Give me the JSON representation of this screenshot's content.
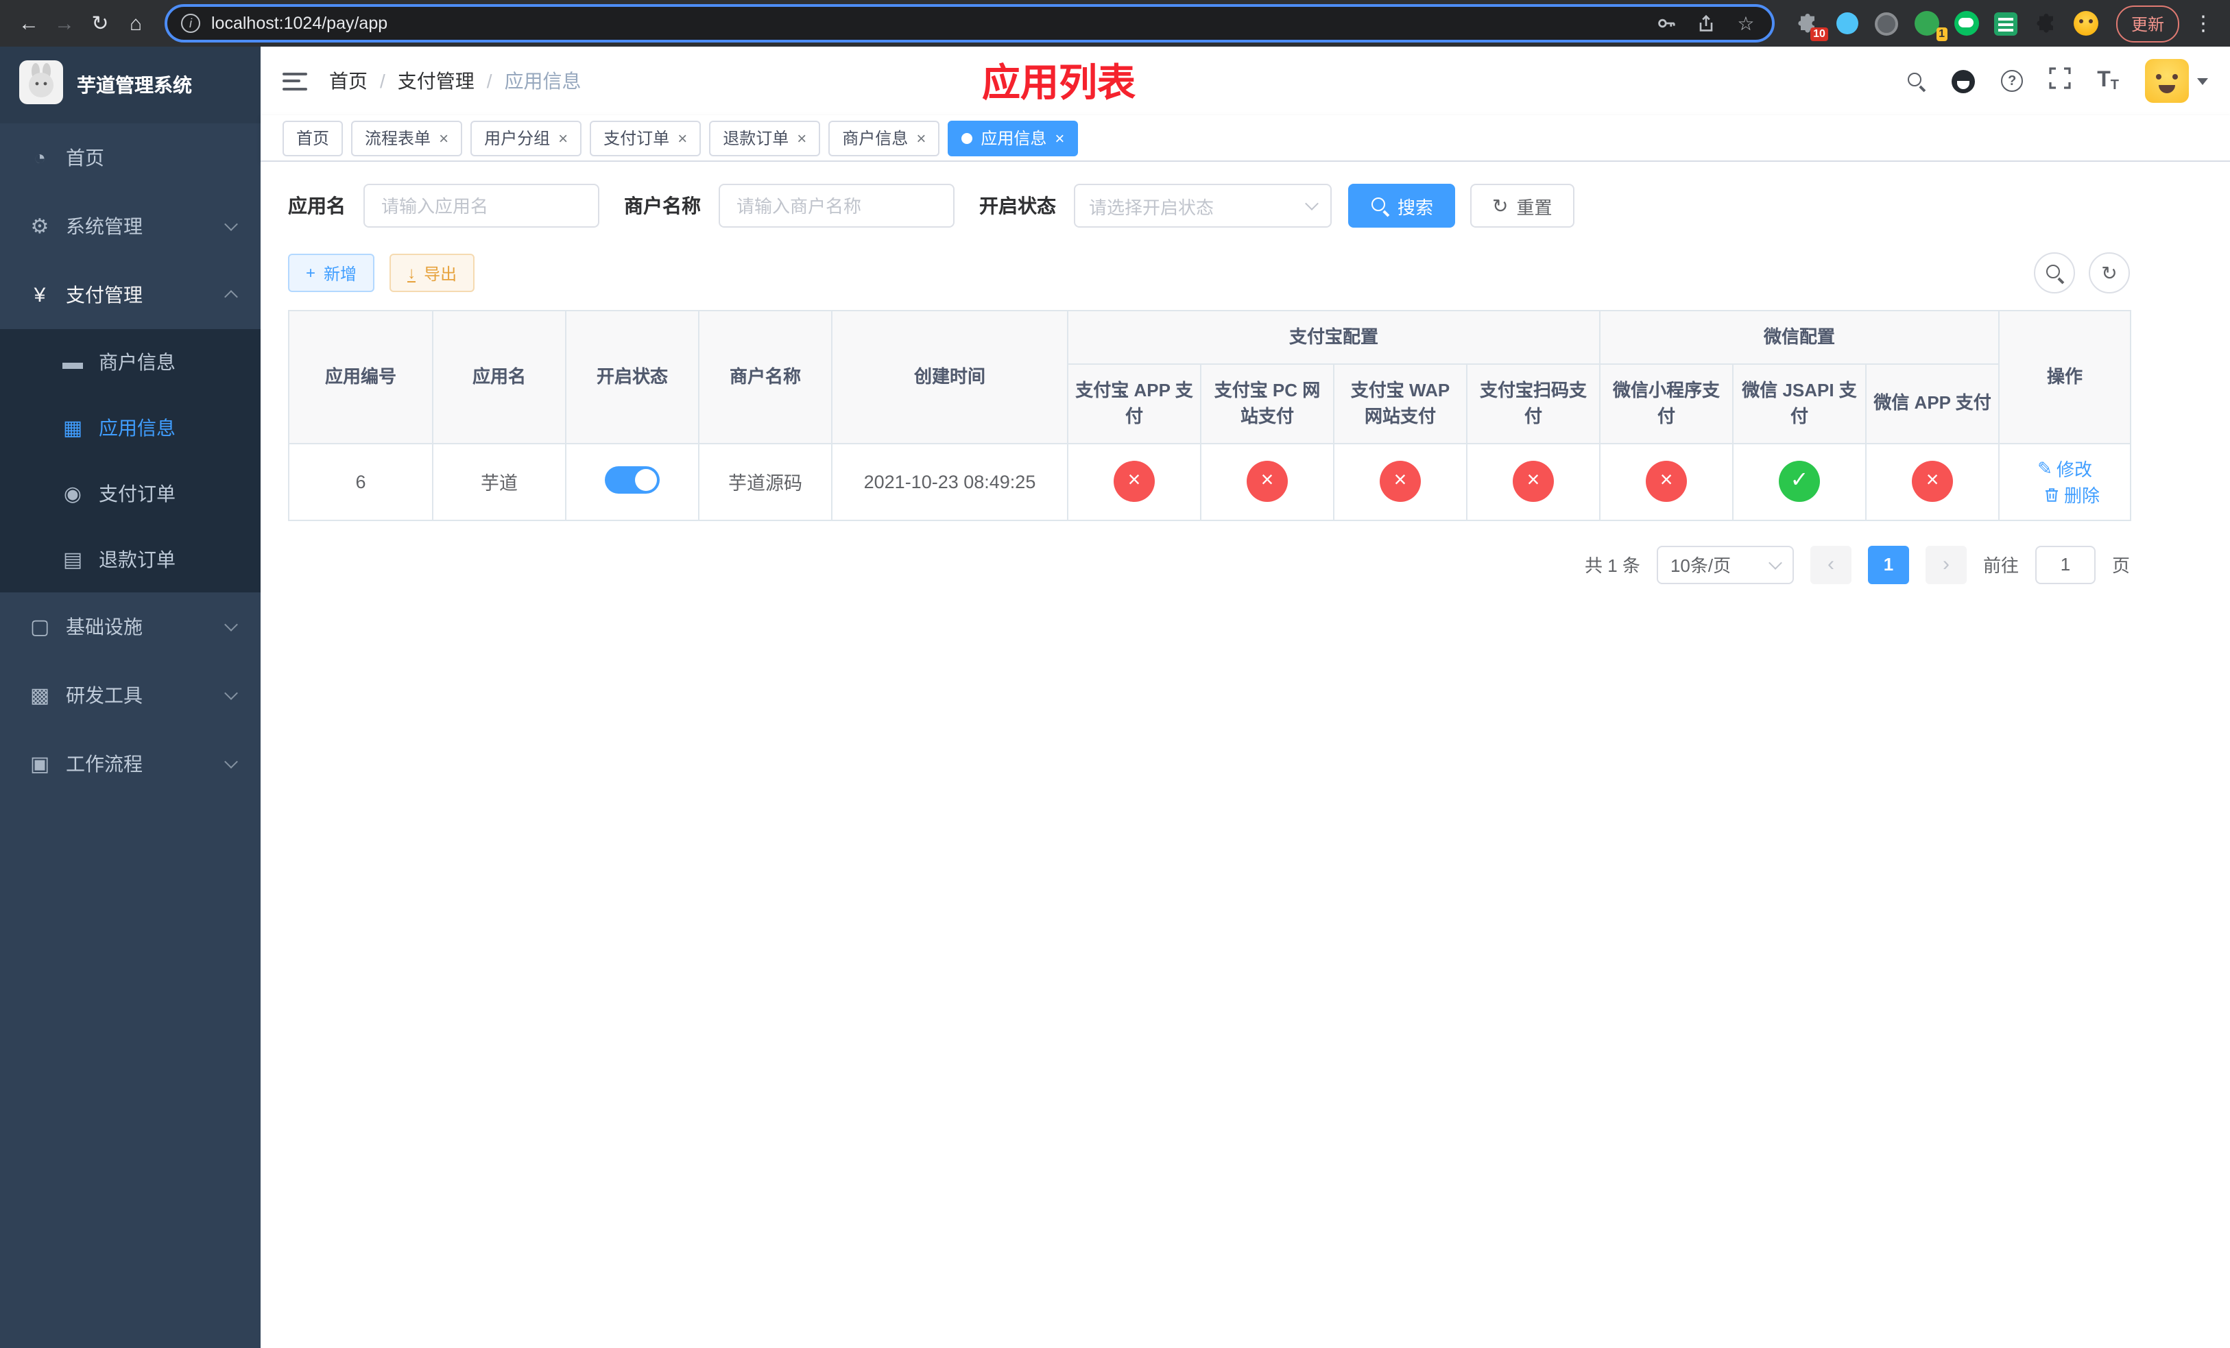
{
  "colors": {
    "accent": "#409eff",
    "danger": "#f75353",
    "success": "#2bc64c",
    "warning": "#e6a23c",
    "title_red": "#f5222d",
    "sidebar_bg": "#304156",
    "submenu_bg": "#1f2d3d"
  },
  "icons": {
    "back": "←",
    "forward": "→",
    "reload": "↻",
    "home": "⌂",
    "info": "i",
    "star": "☆",
    "menu_dots": "⋮",
    "dashboard": "◔",
    "gear": "⚙",
    "yen": "¥",
    "merchant": "▬",
    "app": "▦",
    "order": "◉",
    "refund": "▤",
    "infra": "▢",
    "tools": "▩",
    "workflow": "▣",
    "question": "?",
    "close": "×",
    "check": "✓",
    "cross": "×",
    "refresh": "↻",
    "plus": "+",
    "download": "↓",
    "edit": "✎",
    "prev": "‹",
    "next": "›",
    "font_size": "T"
  },
  "browser": {
    "url": "localhost:1024/pay/app",
    "update_label": "更新",
    "puzzle_badge": "10",
    "avatar_badge": "1"
  },
  "sidebar": {
    "title": "芋道管理系统",
    "items": [
      {
        "label": "首页"
      },
      {
        "label": "系统管理"
      },
      {
        "label": "支付管理"
      },
      {
        "label": "基础设施"
      },
      {
        "label": "研发工具"
      },
      {
        "label": "工作流程"
      }
    ],
    "payment_children": [
      {
        "label": "商户信息"
      },
      {
        "label": "应用信息"
      },
      {
        "label": "支付订单"
      },
      {
        "label": "退款订单"
      }
    ]
  },
  "header": {
    "separator": "/",
    "breadcrumb": [
      {
        "label": "首页"
      },
      {
        "label": "支付管理"
      },
      {
        "label": "应用信息"
      }
    ],
    "page_title": "应用列表"
  },
  "tabs": [
    {
      "label": "首页"
    },
    {
      "label": "流程表单"
    },
    {
      "label": "用户分组"
    },
    {
      "label": "支付订单"
    },
    {
      "label": "退款订单"
    },
    {
      "label": "商户信息"
    },
    {
      "label": "应用信息"
    }
  ],
  "filters": {
    "app_name_label": "应用名",
    "app_name_placeholder": "请输入应用名",
    "merchant_label": "商户名称",
    "merchant_placeholder": "请输入商户名称",
    "status_label": "开启状态",
    "status_placeholder": "请选择开启状态",
    "search_label": "搜索",
    "reset_label": "重置"
  },
  "toolbar": {
    "add_label": "新增",
    "export_label": "导出"
  },
  "table": {
    "col_app_id": "应用编号",
    "col_app_name": "应用名",
    "col_status": "开启状态",
    "col_merchant": "商户名称",
    "col_created": "创建时间",
    "group_alipay": "支付宝配置",
    "group_wechat": "微信配置",
    "col_alipay_app": "支付宝 APP 支付",
    "col_alipay_pc": "支付宝 PC 网站支付",
    "col_alipay_wap": "支付宝 WAP 网站支付",
    "col_alipay_qr": "支付宝扫码支付",
    "col_wx_mini": "微信小程序支付",
    "col_wx_jsapi": "微信 JSAPI 支付",
    "col_wx_app": "微信 APP 支付",
    "col_actions": "操作",
    "row": {
      "app_id": "6",
      "app_name": "芋道",
      "enabled": true,
      "merchant": "芋道源码",
      "created_at": "2021-10-23 08:49:25",
      "alipay_app": false,
      "alipay_pc": false,
      "alipay_wap": false,
      "alipay_qr": false,
      "wx_mini": false,
      "wx_jsapi": true,
      "wx_app": false,
      "edit_label": "修改",
      "delete_label": "删除"
    }
  },
  "pagination": {
    "total_label": "共 1 条",
    "page_size_label": "10条/页",
    "current_page": "1",
    "goto_label": "前往",
    "goto_value": "1",
    "page_suffix": "页"
  }
}
